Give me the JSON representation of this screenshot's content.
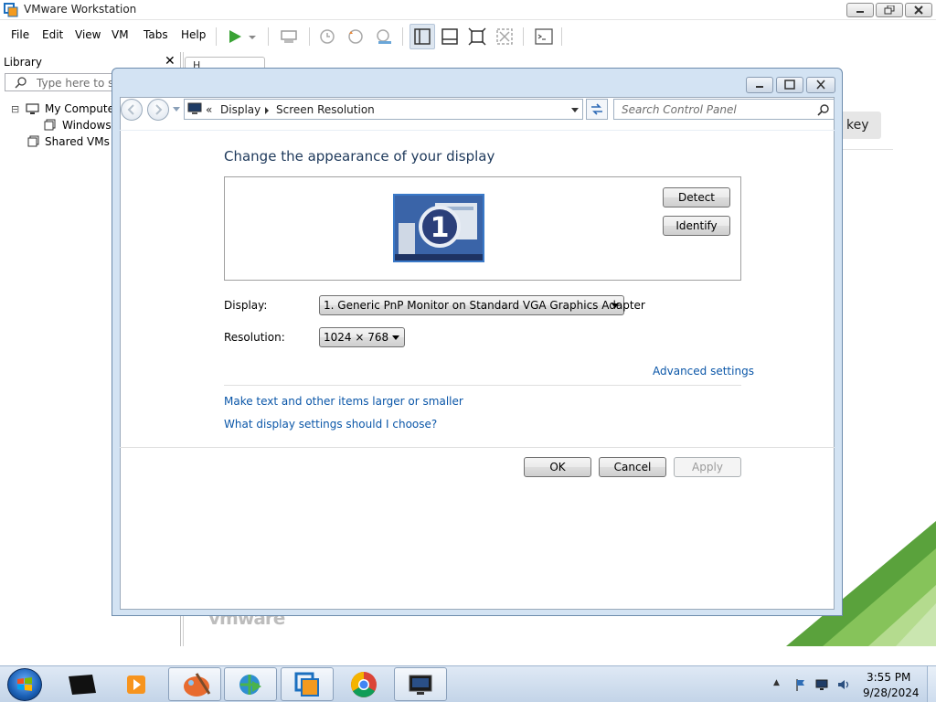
{
  "app": {
    "title": "VMware Workstation",
    "menu": [
      "File",
      "Edit",
      "View",
      "VM",
      "Tabs",
      "Help"
    ]
  },
  "library": {
    "header": "Library",
    "close": "✕",
    "search_placeholder": "Type here to sea",
    "tree": [
      {
        "label": "My Computer",
        "expander": "⊟"
      },
      {
        "label": "Windows I"
      },
      {
        "label": "Shared VMs"
      }
    ]
  },
  "background": {
    "tab_label": "H",
    "key_button": "key",
    "logo": "vmware"
  },
  "dialog": {
    "address": {
      "chevrons": "«",
      "crumbs": [
        "Display",
        "Screen Resolution"
      ]
    },
    "search_placeholder": "Search Control Panel",
    "heading": "Change the appearance of your display",
    "monitor_number": "1",
    "detect_label": "Detect",
    "identify_label": "Identify",
    "display_label": "Display:",
    "display_value": "1. Generic PnP Monitor on Standard VGA Graphics Adapter",
    "resolution_label": "Resolution:",
    "resolution_value": "1024 × 768",
    "advanced_link": "Advanced settings",
    "link_text_size": "Make text and other items larger or smaller",
    "link_help": "What display settings should I choose?",
    "ok_label": "OK",
    "cancel_label": "Cancel",
    "apply_label": "Apply"
  },
  "taskbar": {
    "time": "3:55 PM",
    "date": "9/28/2024",
    "tray_arrow": "▲"
  },
  "colors": {
    "link": "#0a56a8",
    "heading": "#1e395b",
    "dialog_frame": "#d3e3f3",
    "play_green": "#3aa335",
    "vmware_green": "#6cb33f"
  }
}
